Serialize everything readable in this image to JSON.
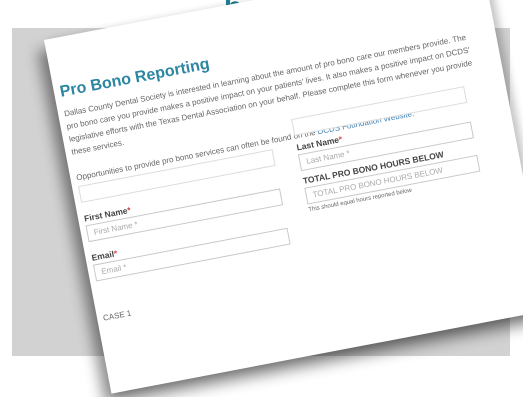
{
  "top_heading": "bono",
  "form": {
    "title": "Pro Bono Reporting",
    "intro_text": "Dallas County Dental Society is interested in learning about the amount of pro bono care our members provide. The pro bono care you provide makes a positive impact on your patients' lives. It also makes a positive impact on DCDS' legislative efforts with the Texas Dental Association on your behalf. Please complete this form whenever you provide these services.",
    "opportunities_text": "Opportunities to provide pro bono services can often be found on the",
    "foundation_link": "DCDS Foundation Website",
    "opportunities_end": ".",
    "required_mark": "*",
    "first_name": {
      "label": "First Name",
      "placeholder": "First Name *"
    },
    "last_name": {
      "label": "Last Name",
      "placeholder": "Last Name *"
    },
    "email": {
      "label": "Email",
      "placeholder": "Email *"
    },
    "total_hours": {
      "label": "TOTAL PRO BONO HOURS BELOW",
      "placeholder": "TOTAL PRO BONO HOURS BELOW",
      "hint": "This should equal hours reported below"
    },
    "case_label": "CASE 1"
  }
}
